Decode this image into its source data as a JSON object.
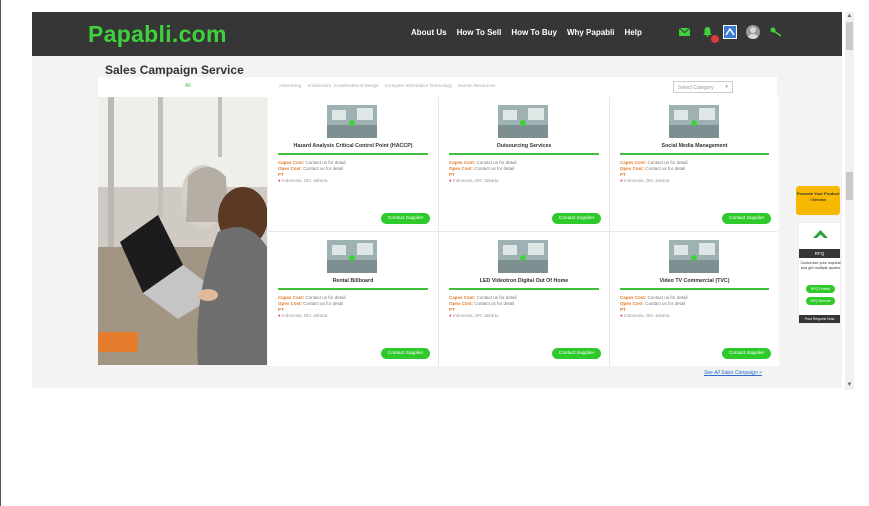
{
  "header": {
    "logo": "Papabli.com",
    "nav": [
      "About Us",
      "How To Sell",
      "How To Buy",
      "Why Papabli",
      "Help"
    ]
  },
  "page": {
    "title": "Sales Campaign Service",
    "see_all": "See All Sales Campaign »"
  },
  "categories": {
    "active": "All",
    "items": [
      "Advertising",
      "Architecture, Construction & Design",
      "Computer Information Technology",
      "Human Resources"
    ],
    "select_placeholder": "Select Category"
  },
  "cards": [
    {
      "title": "Hazard Analysis Critical Control Point (HACCP)",
      "capex_label": "Capex Cost:",
      "capex": "Contact us for detail",
      "opex_label": "Opex Cost:",
      "opex": "Contact us for detail",
      "company": "PT",
      "location": "Indonesia, DKI Jakarta",
      "button": "Contact Supplier"
    },
    {
      "title": "Outsourcing Services",
      "capex_label": "Capex Cost:",
      "capex": "Contact us for detail",
      "opex_label": "Opex Cost:",
      "opex": "Contact us for detail",
      "company": "PT",
      "location": "Indonesia, DKI Jakarta",
      "button": "Contact Supplier"
    },
    {
      "title": "Social Media Management",
      "capex_label": "Capex Cost:",
      "capex": "Contact us for detail",
      "opex_label": "Opex Cost:",
      "opex": "Contact us for detail",
      "company": "PT",
      "location": "Indonesia, DKI Jakarta",
      "button": "Contact Supplier"
    },
    {
      "title": "Rental Billboard",
      "capex_label": "Capex Cost:",
      "capex": "Contact us for detail",
      "opex_label": "Opex Cost:",
      "opex": "Contact us for detail",
      "company": "PT",
      "location": "Indonesia, DKI Jakarta",
      "button": "Contact Supplier"
    },
    {
      "title": "LED Videotron Digital Out Of Home",
      "capex_label": "Capex Cost:",
      "capex": "Contact us for detail",
      "opex_label": "Opex Cost:",
      "opex": "Contact us for detail",
      "company": "PT",
      "location": "Indonesia, DKI Jakarta",
      "button": "Contact Supplier"
    },
    {
      "title": "Video TV Commercial (TVC)",
      "capex_label": "Capex Cost:",
      "capex": "Contact us for detail",
      "opex_label": "Opex Cost:",
      "opex": "Contact us for detail",
      "company": "PT",
      "location": "Indonesia, DKI Jakarta",
      "button": "Contact Supplier"
    }
  ],
  "sidebar_widgets": {
    "promote": "Promote Your Product / Service",
    "rfq_label": "RFQ",
    "rfq_text": "Customize your request and get multiple quotes",
    "rfq_posted": "RFQ Posted",
    "rfq_service": "RFQ Service",
    "post_request": "Post Request Now"
  },
  "icons": {
    "mail": "mail-icon",
    "bell": "bell-icon",
    "app": "app-icon",
    "avatar": "avatar",
    "key": "key-icon"
  },
  "colors": {
    "brand_green": "#3fd13b",
    "header_bg": "#363636",
    "button_green": "#2ec92a",
    "cost_orange": "#e07b2a",
    "promo_yellow": "#f6b800",
    "link_blue": "#2a6bd1"
  }
}
